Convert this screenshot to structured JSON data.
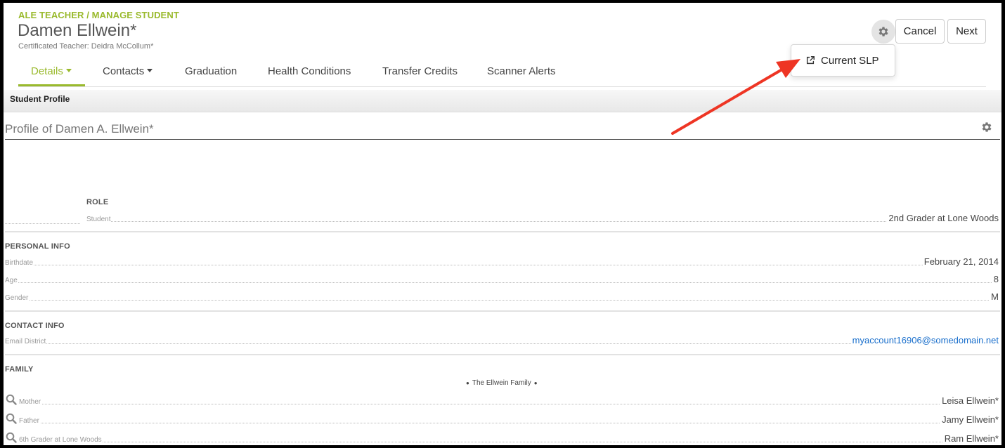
{
  "header": {
    "breadcrumb": "ALE TEACHER / MANAGE STUDENT",
    "student_name": "Damen Ellwein*",
    "certificated_teacher": "Certificated Teacher: Deidra McCollum*",
    "cancel_label": "Cancel",
    "next_label": "Next",
    "settings_icon": "gear-icon"
  },
  "dropdown": {
    "item_label": "Current SLP",
    "item_icon": "external-link-icon"
  },
  "tabs": [
    {
      "label": "Details",
      "has_caret": true,
      "active": true
    },
    {
      "label": "Contacts",
      "has_caret": true,
      "active": false
    },
    {
      "label": "Graduation",
      "has_caret": false,
      "active": false
    },
    {
      "label": "Health Conditions",
      "has_caret": false,
      "active": false
    },
    {
      "label": "Transfer Credits",
      "has_caret": false,
      "active": false
    },
    {
      "label": "Scanner Alerts",
      "has_caret": false,
      "active": false
    }
  ],
  "subbar": {
    "title": "Student Profile"
  },
  "profile": {
    "title": "Profile of Damen A. Ellwein*",
    "role": {
      "heading": "ROLE",
      "label": "Student",
      "value": "2nd Grader at Lone Woods"
    },
    "personal_info": {
      "heading": "PERSONAL INFO",
      "rows": [
        {
          "label": "Birthdate",
          "value": "February 21, 2014"
        },
        {
          "label": "Age",
          "value": "8"
        },
        {
          "label": "Gender",
          "value": "M"
        }
      ]
    },
    "contact_info": {
      "heading": "CONTACT INFO",
      "rows": [
        {
          "label": "Email District",
          "value": "myaccount16906@somedomain.net"
        }
      ]
    },
    "family": {
      "heading": "FAMILY",
      "family_name": "The Ellwein Family",
      "members": [
        {
          "label": "Mother",
          "value": "Leisa Ellwein*"
        },
        {
          "label": "Father",
          "value": "Jamy Ellwein*"
        },
        {
          "label": "6th Grader at Lone Woods",
          "value": "Ram Ellwein*"
        }
      ]
    }
  },
  "colors": {
    "accent": "#9aba2d",
    "link": "#1a6fcc",
    "annotation_arrow": "#ee3524"
  }
}
